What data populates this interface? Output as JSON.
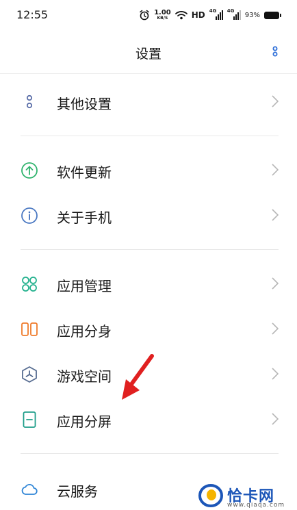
{
  "status_bar": {
    "time": "12:55",
    "net_speed_value": "1.00",
    "net_speed_unit": "KB/S",
    "hd_label": "HD",
    "signal1_type": "4G",
    "signal2_type": "4G",
    "battery_percent": "93%"
  },
  "header": {
    "title": "设置",
    "menu_icon": "more-vertical-icon"
  },
  "settings_groups": [
    {
      "items": [
        {
          "label": "其他设置",
          "icon": "more-dots-icon",
          "color": "#5a6ea8"
        }
      ]
    },
    {
      "items": [
        {
          "label": "软件更新",
          "icon": "upload-arrow-icon",
          "color": "#2fb36d"
        },
        {
          "label": "关于手机",
          "icon": "info-icon",
          "color": "#4a78c2"
        }
      ]
    },
    {
      "items": [
        {
          "label": "应用管理",
          "icon": "app-grid-icon",
          "color": "#26b28f"
        },
        {
          "label": "应用分身",
          "icon": "app-clone-icon",
          "color": "#ef7a2a"
        },
        {
          "label": "游戏空间",
          "icon": "game-space-icon",
          "color": "#556b90"
        },
        {
          "label": "应用分屏",
          "icon": "split-screen-icon",
          "color": "#1f9e8a"
        }
      ]
    },
    {
      "items": [
        {
          "label": "云服务",
          "icon": "cloud-icon",
          "color": "#2d84d6"
        }
      ]
    }
  ],
  "annotation": {
    "arrow_color": "#e02020"
  },
  "watermark": {
    "brand": "恰卡网",
    "url": "www.qiaqa.com",
    "color": "#1c56b8"
  }
}
